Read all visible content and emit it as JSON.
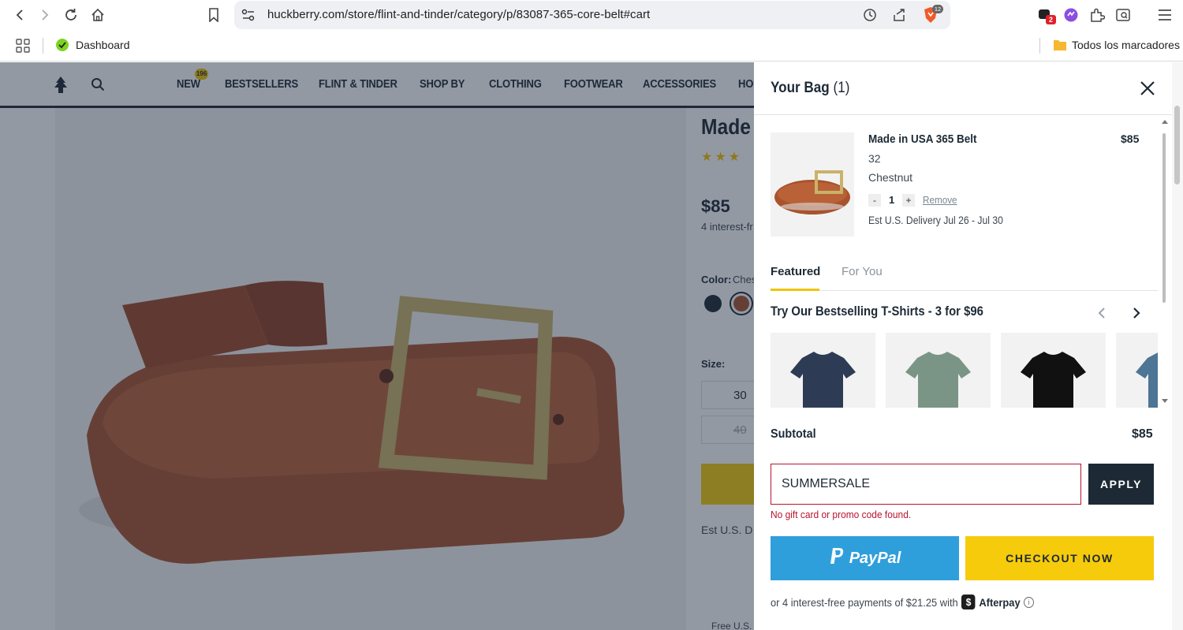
{
  "browser": {
    "url": "huckberry.com/store/flint-and-tinder/category/p/83087-365-core-belt#cart",
    "extension_badges": [
      "2",
      "12"
    ],
    "bookmarks": {
      "dashboard": "Dashboard",
      "all_bookmarks": "Todos los marcadores"
    }
  },
  "site_nav": {
    "items": [
      "NEW",
      "BESTSELLERS",
      "FLINT & TINDER",
      "SHOP BY",
      "CLOTHING",
      "FOOTWEAR",
      "ACCESSORIES",
      "HO"
    ],
    "new_badge": "196"
  },
  "product": {
    "title_fragment": "Made",
    "price": "$85",
    "interest_fragment": "4 interest-fr",
    "color_label": "Color:",
    "color_value_fragment": "Ches",
    "size_label": "Size:",
    "sizes": [
      "30",
      "40"
    ],
    "est_fragment": "Est U.S. D",
    "free_fragment": "Free U.S."
  },
  "cart": {
    "title": "Your Bag",
    "count": "(1)",
    "item": {
      "name": "Made in USA 365 Belt",
      "price": "$85",
      "size": "32",
      "color": "Chestnut",
      "qty": "1",
      "minus": "-",
      "plus": "+",
      "remove": "Remove",
      "delivery": "Est U.S. Delivery Jul 26 - Jul 30"
    },
    "tabs": [
      "Featured",
      "For You"
    ],
    "recommend_title": "Try Our Bestselling T-Shirts - 3 for $96",
    "tshirt_colors": [
      "#2e3b55",
      "#7a9585",
      "#111111",
      "#4c7596"
    ],
    "subtotal_label": "Subtotal",
    "subtotal_value": "$85",
    "promo_value": "SUMMERSALE",
    "apply_label": "APPLY",
    "promo_error": "No gift card or promo code found.",
    "paypal_label": "PayPal",
    "checkout_label": "CHECKOUT NOW",
    "afterpay_text": "or 4 interest-free payments of $21.25 with",
    "afterpay_brand": "Afterpay"
  },
  "colors": {
    "navy": "#1d2a35",
    "yellow": "#f6cb0b",
    "paypal_blue": "#2f9fdb",
    "error_red": "#b8142d",
    "belt_brown": "#a8532e"
  }
}
